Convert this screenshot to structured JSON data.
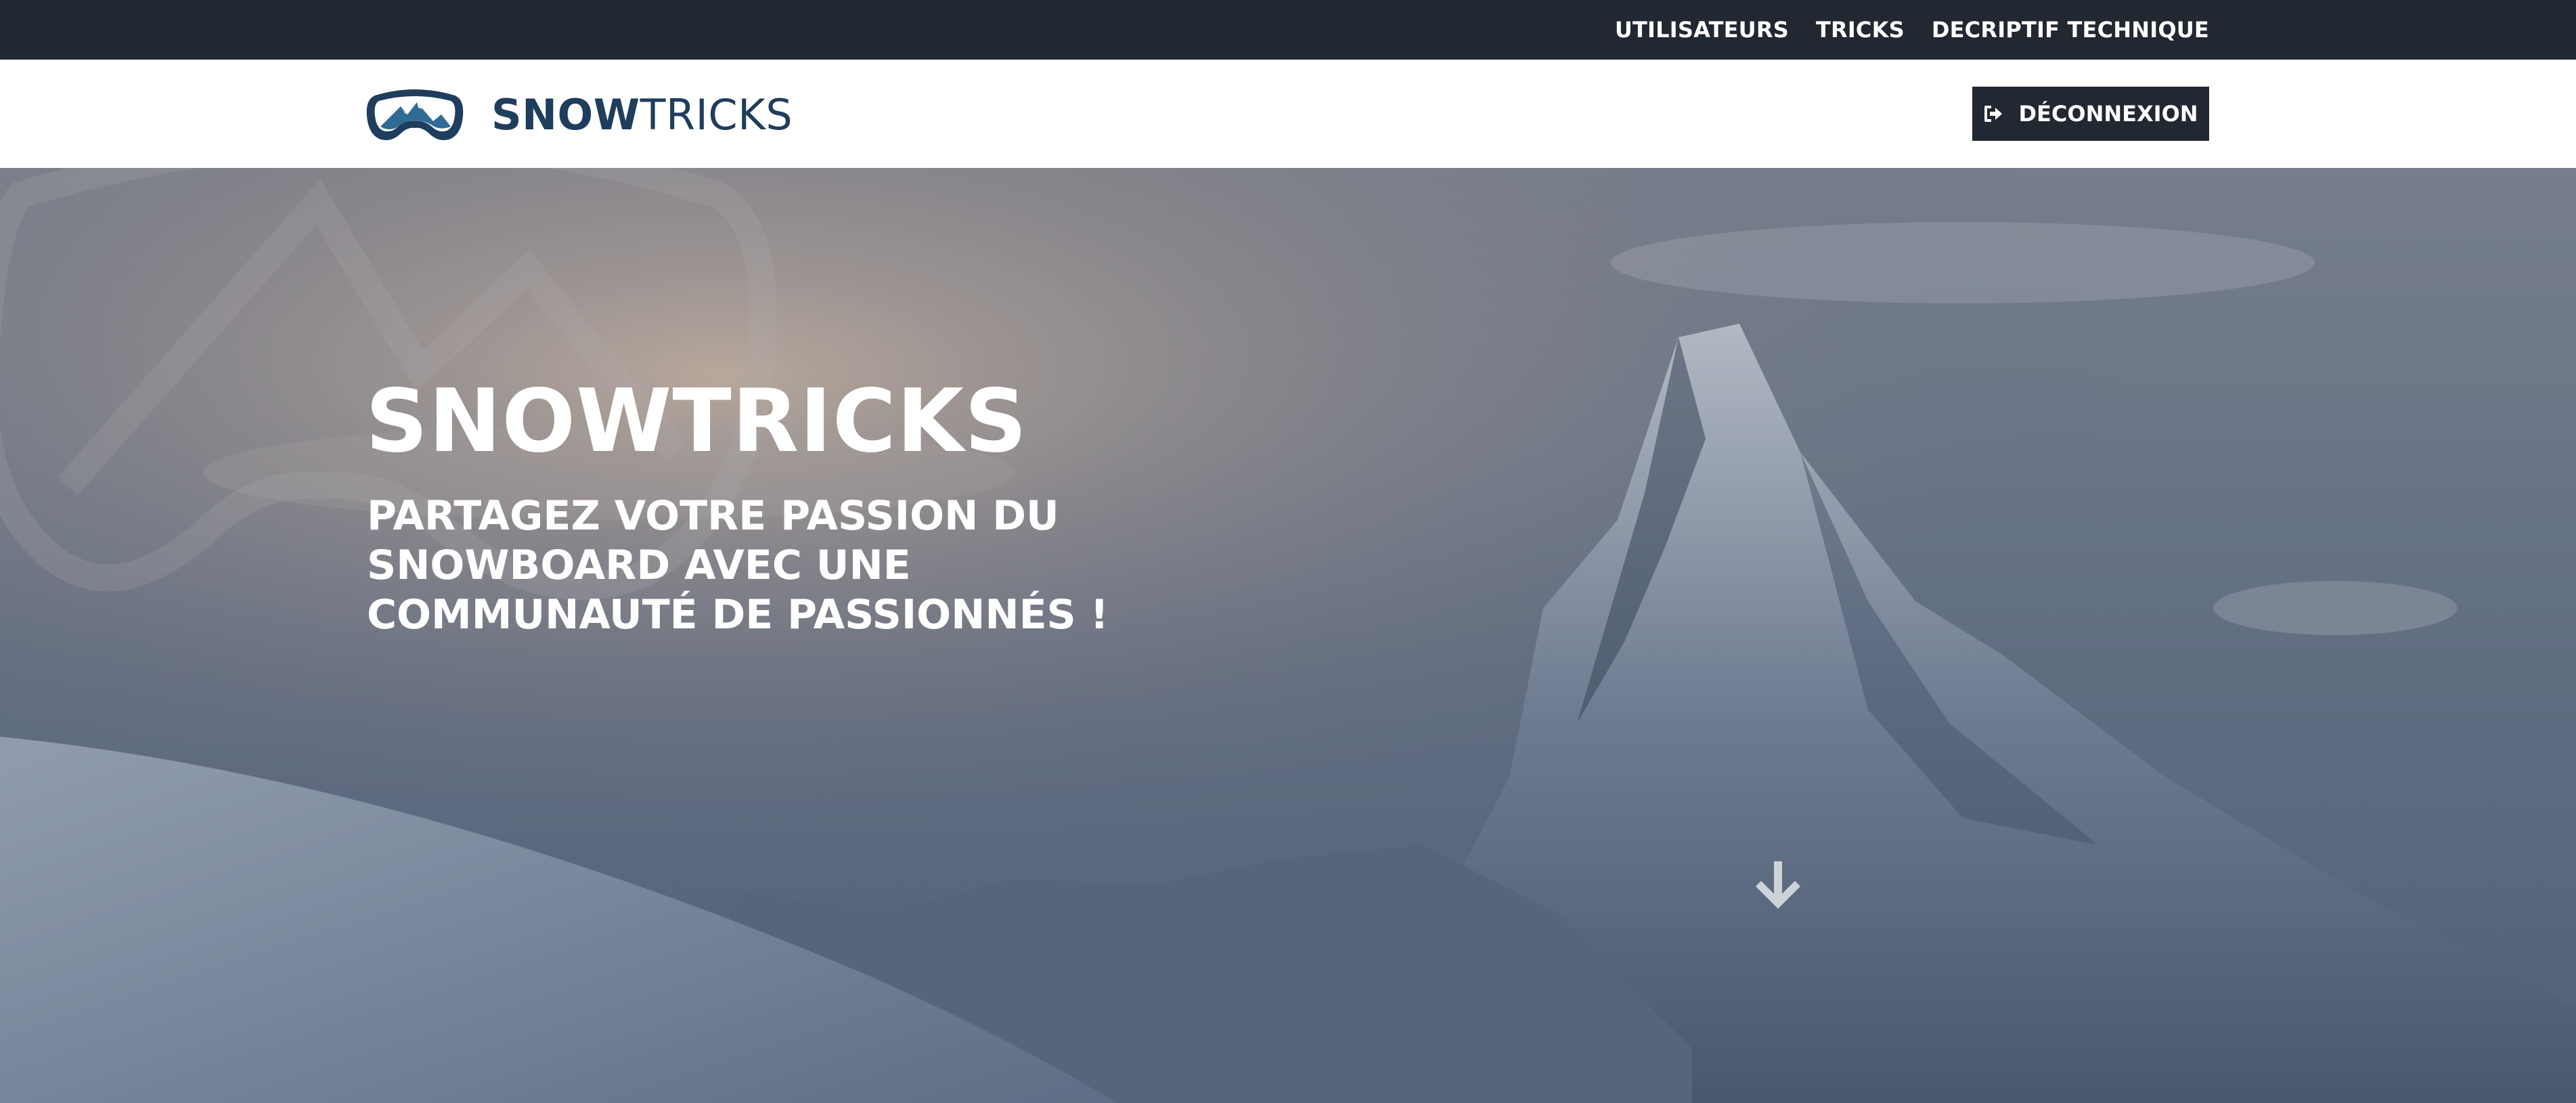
{
  "topnav": {
    "items": [
      {
        "label": "UTILISATEURS"
      },
      {
        "label": "TRICKS"
      },
      {
        "label": "DECRIPTIF TECHNIQUE"
      }
    ]
  },
  "header": {
    "brand": {
      "bold": "SNOW",
      "light": "TRICKS",
      "icon": "goggles-mountain-logo"
    },
    "logout": {
      "label": "DÉCONNEXION",
      "icon": "sign-out-icon"
    }
  },
  "hero": {
    "title": "SNOWTRICKS",
    "subtitle": "PARTAGEZ VOTRE PASSION DU SNOWBOARD AVEC UNE COMMUNAUTÉ DE PASSIONNÉS !",
    "scroll_icon": "arrow-down-icon"
  },
  "colors": {
    "dark": "#212831",
    "brand": "#1f3d5c",
    "white": "#ffffff"
  }
}
